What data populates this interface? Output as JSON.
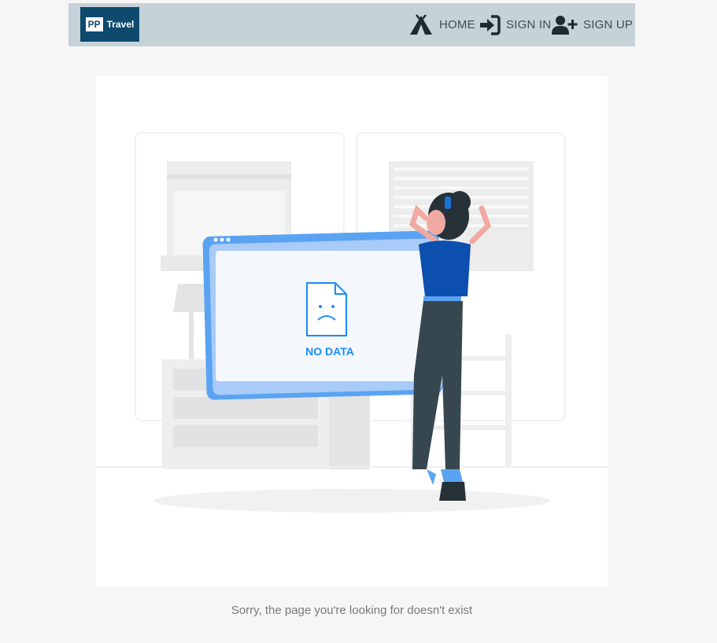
{
  "navbar": {
    "logo": {
      "short": "PP",
      "name": "Travel"
    },
    "items": [
      {
        "label": "HOME",
        "icon": "camp-tent-icon"
      },
      {
        "label": "SIGN IN",
        "icon": "sign-in-icon"
      },
      {
        "label": "SIGN UP",
        "icon": "user-plus-icon"
      }
    ]
  },
  "illustration": {
    "screen_text": "NO DATA",
    "accent_color": "#1a8cf5",
    "navbar_color": "#c5d2d8",
    "logo_color": "#0d4a6e"
  },
  "message": "Sorry, the page you're looking for doesn't exist"
}
